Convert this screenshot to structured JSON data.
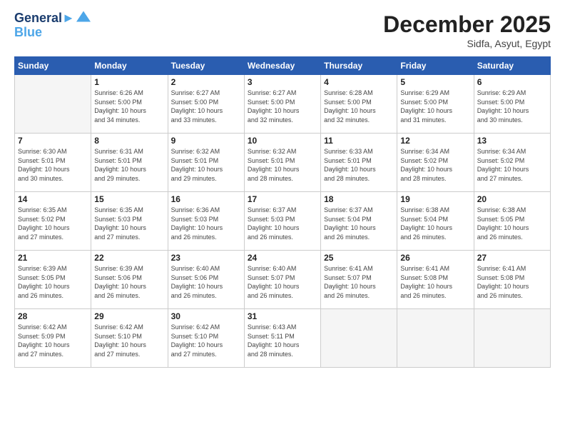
{
  "logo": {
    "line1": "General",
    "line2": "Blue"
  },
  "header": {
    "month": "December 2025",
    "location": "Sidfa, Asyut, Egypt"
  },
  "days_of_week": [
    "Sunday",
    "Monday",
    "Tuesday",
    "Wednesday",
    "Thursday",
    "Friday",
    "Saturday"
  ],
  "weeks": [
    [
      {
        "num": "",
        "empty": true
      },
      {
        "num": "1",
        "sunrise": "6:26 AM",
        "sunset": "5:00 PM",
        "daylight": "10 hours and 34 minutes."
      },
      {
        "num": "2",
        "sunrise": "6:27 AM",
        "sunset": "5:00 PM",
        "daylight": "10 hours and 33 minutes."
      },
      {
        "num": "3",
        "sunrise": "6:27 AM",
        "sunset": "5:00 PM",
        "daylight": "10 hours and 32 minutes."
      },
      {
        "num": "4",
        "sunrise": "6:28 AM",
        "sunset": "5:00 PM",
        "daylight": "10 hours and 32 minutes."
      },
      {
        "num": "5",
        "sunrise": "6:29 AM",
        "sunset": "5:00 PM",
        "daylight": "10 hours and 31 minutes."
      },
      {
        "num": "6",
        "sunrise": "6:29 AM",
        "sunset": "5:00 PM",
        "daylight": "10 hours and 30 minutes."
      }
    ],
    [
      {
        "num": "7",
        "sunrise": "6:30 AM",
        "sunset": "5:01 PM",
        "daylight": "10 hours and 30 minutes."
      },
      {
        "num": "8",
        "sunrise": "6:31 AM",
        "sunset": "5:01 PM",
        "daylight": "10 hours and 29 minutes."
      },
      {
        "num": "9",
        "sunrise": "6:32 AM",
        "sunset": "5:01 PM",
        "daylight": "10 hours and 29 minutes."
      },
      {
        "num": "10",
        "sunrise": "6:32 AM",
        "sunset": "5:01 PM",
        "daylight": "10 hours and 28 minutes."
      },
      {
        "num": "11",
        "sunrise": "6:33 AM",
        "sunset": "5:01 PM",
        "daylight": "10 hours and 28 minutes."
      },
      {
        "num": "12",
        "sunrise": "6:34 AM",
        "sunset": "5:02 PM",
        "daylight": "10 hours and 28 minutes."
      },
      {
        "num": "13",
        "sunrise": "6:34 AM",
        "sunset": "5:02 PM",
        "daylight": "10 hours and 27 minutes."
      }
    ],
    [
      {
        "num": "14",
        "sunrise": "6:35 AM",
        "sunset": "5:02 PM",
        "daylight": "10 hours and 27 minutes."
      },
      {
        "num": "15",
        "sunrise": "6:35 AM",
        "sunset": "5:03 PM",
        "daylight": "10 hours and 27 minutes."
      },
      {
        "num": "16",
        "sunrise": "6:36 AM",
        "sunset": "5:03 PM",
        "daylight": "10 hours and 26 minutes."
      },
      {
        "num": "17",
        "sunrise": "6:37 AM",
        "sunset": "5:03 PM",
        "daylight": "10 hours and 26 minutes."
      },
      {
        "num": "18",
        "sunrise": "6:37 AM",
        "sunset": "5:04 PM",
        "daylight": "10 hours and 26 minutes."
      },
      {
        "num": "19",
        "sunrise": "6:38 AM",
        "sunset": "5:04 PM",
        "daylight": "10 hours and 26 minutes."
      },
      {
        "num": "20",
        "sunrise": "6:38 AM",
        "sunset": "5:05 PM",
        "daylight": "10 hours and 26 minutes."
      }
    ],
    [
      {
        "num": "21",
        "sunrise": "6:39 AM",
        "sunset": "5:05 PM",
        "daylight": "10 hours and 26 minutes."
      },
      {
        "num": "22",
        "sunrise": "6:39 AM",
        "sunset": "5:06 PM",
        "daylight": "10 hours and 26 minutes."
      },
      {
        "num": "23",
        "sunrise": "6:40 AM",
        "sunset": "5:06 PM",
        "daylight": "10 hours and 26 minutes."
      },
      {
        "num": "24",
        "sunrise": "6:40 AM",
        "sunset": "5:07 PM",
        "daylight": "10 hours and 26 minutes."
      },
      {
        "num": "25",
        "sunrise": "6:41 AM",
        "sunset": "5:07 PM",
        "daylight": "10 hours and 26 minutes."
      },
      {
        "num": "26",
        "sunrise": "6:41 AM",
        "sunset": "5:08 PM",
        "daylight": "10 hours and 26 minutes."
      },
      {
        "num": "27",
        "sunrise": "6:41 AM",
        "sunset": "5:08 PM",
        "daylight": "10 hours and 26 minutes."
      }
    ],
    [
      {
        "num": "28",
        "sunrise": "6:42 AM",
        "sunset": "5:09 PM",
        "daylight": "10 hours and 27 minutes."
      },
      {
        "num": "29",
        "sunrise": "6:42 AM",
        "sunset": "5:10 PM",
        "daylight": "10 hours and 27 minutes."
      },
      {
        "num": "30",
        "sunrise": "6:42 AM",
        "sunset": "5:10 PM",
        "daylight": "10 hours and 27 minutes."
      },
      {
        "num": "31",
        "sunrise": "6:43 AM",
        "sunset": "5:11 PM",
        "daylight": "10 hours and 28 minutes."
      },
      {
        "num": "",
        "empty": true
      },
      {
        "num": "",
        "empty": true
      },
      {
        "num": "",
        "empty": true
      }
    ]
  ]
}
